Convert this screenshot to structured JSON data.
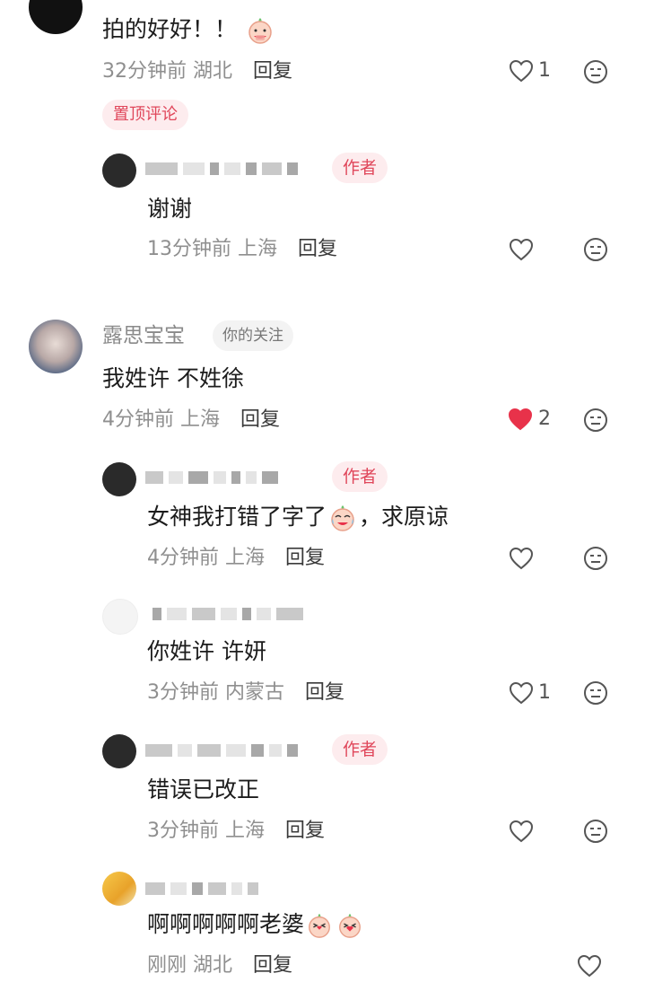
{
  "comments": [
    {
      "text": "拍的好好！！",
      "time": "32分钟前",
      "location": "湖北",
      "reply_label": "回复",
      "likes": "1",
      "pinned_label": "置顶评论",
      "replies": [
        {
          "author_tag": "作者",
          "text": "谢谢",
          "time": "13分钟前",
          "location": "上海",
          "reply_label": "回复",
          "likes": ""
        }
      ]
    },
    {
      "username": "露思宝宝",
      "relation_tag": "你的关注",
      "text": "我姓许 不姓徐",
      "time": "4分钟前",
      "location": "上海",
      "reply_label": "回复",
      "likes": "2",
      "liked": true,
      "replies": [
        {
          "author_tag": "作者",
          "text_before": "女神我打错了字了",
          "text_after": "，求原谅",
          "time": "4分钟前",
          "location": "上海",
          "reply_label": "回复",
          "likes": ""
        },
        {
          "text": "你姓许 许妍",
          "time": "3分钟前",
          "location": "内蒙古",
          "reply_label": "回复",
          "likes": "1"
        },
        {
          "author_tag": "作者",
          "text": "错误已改正",
          "time": "3分钟前",
          "location": "上海",
          "reply_label": "回复",
          "likes": ""
        },
        {
          "text": "啊啊啊啊啊老婆",
          "time": "刚刚",
          "location": "湖北",
          "reply_label": "回复",
          "likes": ""
        }
      ]
    }
  ],
  "colors": {
    "accent": "#e0475b",
    "heart_liked": "#e8324a",
    "meta": "#8f8f8f"
  },
  "icons": [
    "heart-outline-icon",
    "heart-filled-icon",
    "neutral-face-icon",
    "emoji-sticker-icon",
    "crying-laugh-emoji-icon"
  ]
}
